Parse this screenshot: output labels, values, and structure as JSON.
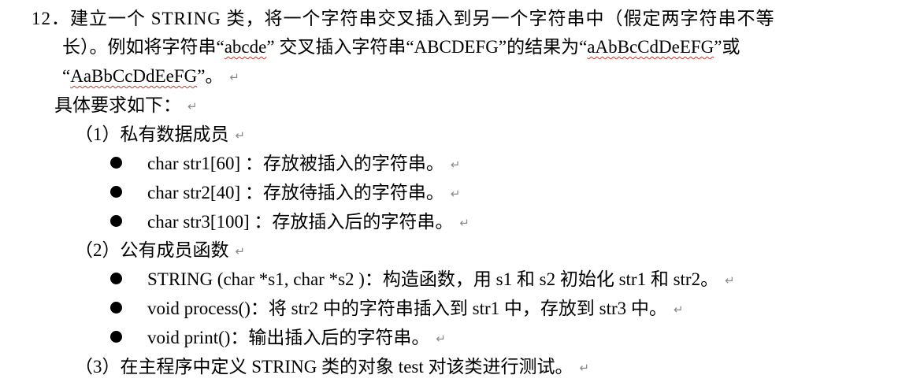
{
  "paragraph_mark": "↵",
  "problem": {
    "line1": "12．建立一个 STRING 类，将一个字符串交叉插入到另一个字符串中（假定两字符串不等",
    "line2_before": "长）。例如将字符串“",
    "line2_ex1": "abcde",
    "line2_mid": "” 交叉插入字符串“ABCDEFG”的结果为“",
    "line2_ex2": "aAbBcCdDeEFG",
    "line2_end": "”或",
    "line3_before": "“",
    "line3_ex3": "AaBbCcDdEeFG",
    "line3_end": "”。"
  },
  "requirements_heading": "具体要求如下：",
  "sections": [
    {
      "heading": "（1）私有数据成员",
      "items": [
        "char str1[60] ：存放被插入的字符串。",
        "char str2[40] ：存放待插入的字符串。",
        "char str3[100] ：存放插入后的字符串。"
      ]
    },
    {
      "heading": "（2）公有成员函数",
      "items": [
        "STRING (char *s1, char *s2 )：构造函数，用 s1 和 s2 初始化 str1 和 str2。",
        "void process()：将 str2 中的字符串插入到 str1 中，存放到 str3 中。",
        "void print()：输出插入后的字符串。"
      ]
    },
    {
      "heading": "（3）在主程序中定义 STRING 类的对象 test 对该类进行测试。",
      "items": []
    }
  ]
}
